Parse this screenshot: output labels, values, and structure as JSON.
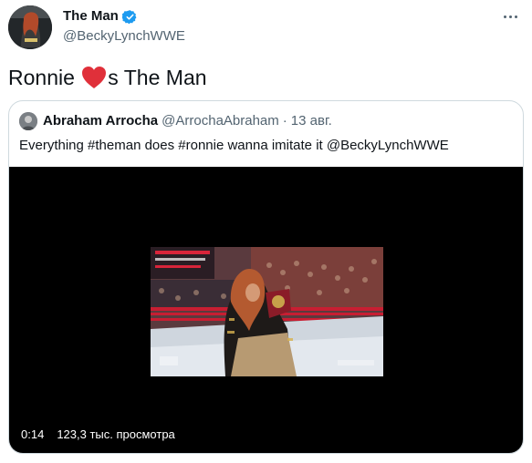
{
  "tweet": {
    "author_name": "The Man",
    "author_handle": "@BeckyLynchWWE",
    "text_before": "Ronnie ",
    "text_after": "s The Man"
  },
  "quote": {
    "author_name": "Abraham Arrocha",
    "author_handle": "@ArrochaAbraham",
    "separator": "·",
    "date": "13 авг.",
    "text": "Everything #theman does #ronnie wanna imitate it @BeckyLynchWWE",
    "video": {
      "duration": "0:14",
      "views": "123,3 тыс. просмотра"
    }
  },
  "icons": {
    "verified": "verified-badge-icon",
    "more": "more-options-icon",
    "heart": "red-heart-emoji"
  },
  "colors": {
    "verified": "#1d9bf0",
    "heart": "#e0303a",
    "secondary_text": "#536471",
    "border": "#cfd9de"
  }
}
